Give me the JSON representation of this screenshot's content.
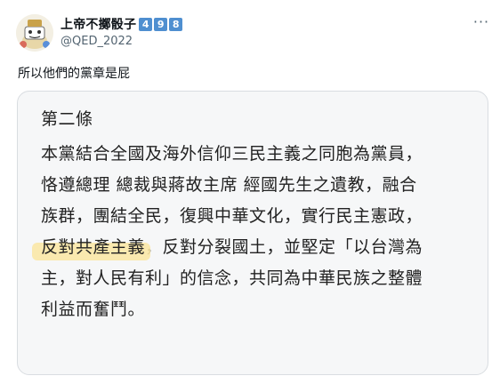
{
  "user": {
    "display_name": "上帝不擲骰子",
    "badge_digits": [
      "4",
      "9",
      "8"
    ],
    "handle": "@QED_2022"
  },
  "tweet": {
    "text": "所以他們的黨章是屁",
    "more_icon": "more-dots-icon"
  },
  "document": {
    "title": "第二條",
    "lines": [
      {
        "plain": "本黨結合全國及海外信仰三民主義之同胞為黨員，"
      },
      {
        "plain": "恪遵總理 總裁與蔣故主席 經國先生之遺教，融合"
      },
      {
        "plain": "族群，團結全民，復興中華文化，實行民主憲政，"
      },
      {
        "highlight": "反對共產主義",
        "rest": "，反對分裂國土，並堅定「以台灣為"
      },
      {
        "plain": "主，對人民有利」的信念，共同為中華民族之整體"
      },
      {
        "plain": "利益而奮鬥。"
      }
    ],
    "highlight_color": "#fbe7a6"
  }
}
